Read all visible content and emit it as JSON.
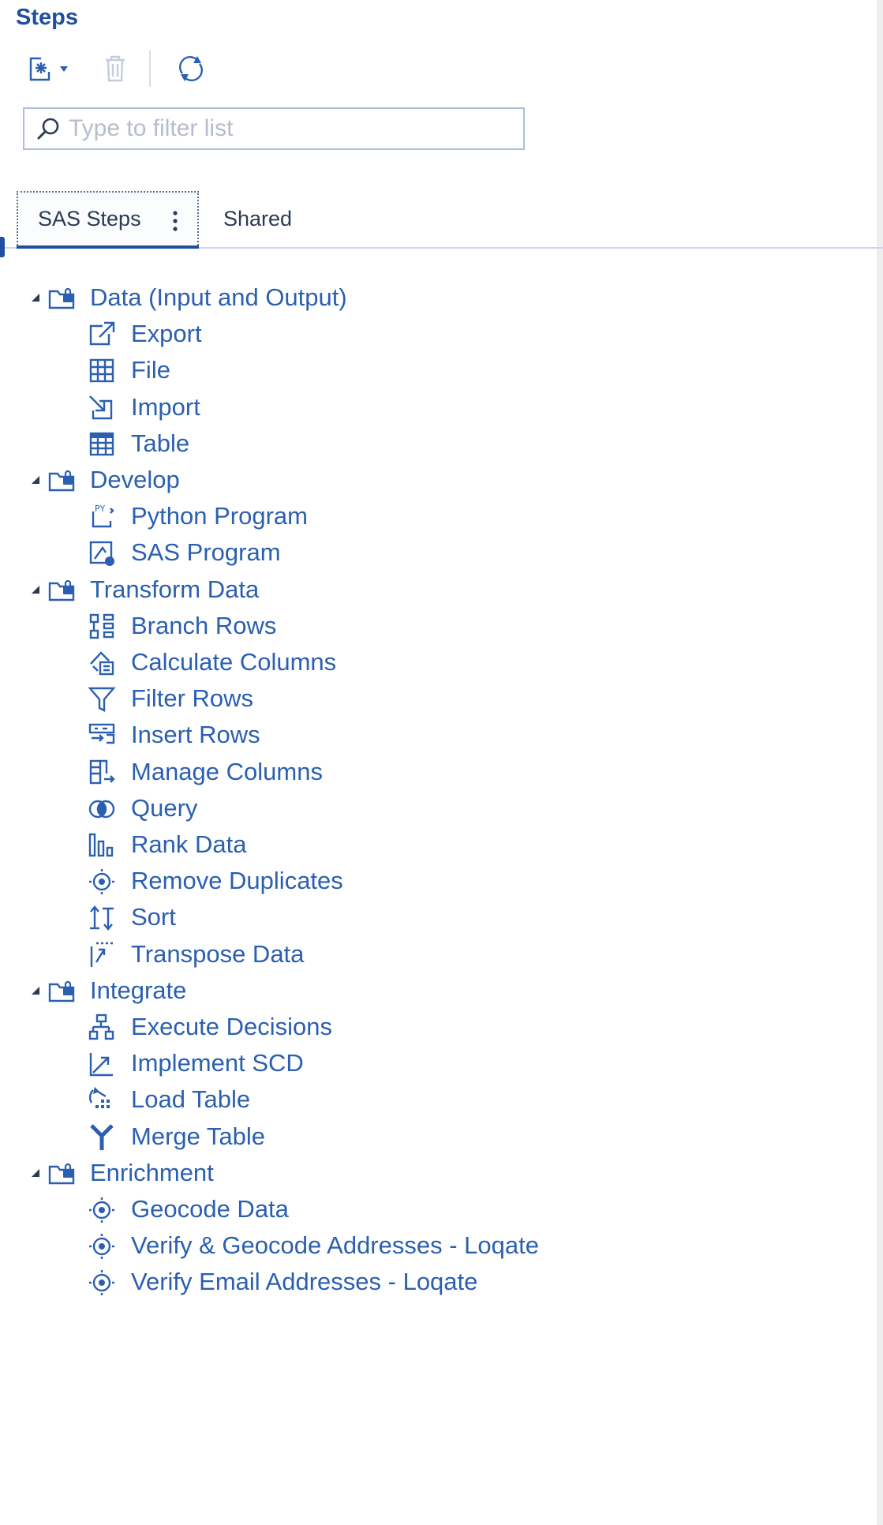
{
  "panel": {
    "title": "Steps"
  },
  "toolbar": {
    "new_icon": "new-step-icon",
    "delete_icon": "trash-icon",
    "refresh_icon": "refresh-icon"
  },
  "filter": {
    "placeholder": "Type to filter list",
    "value": ""
  },
  "tabs": [
    {
      "label": "SAS Steps",
      "active": true
    },
    {
      "label": "Shared",
      "active": false
    }
  ],
  "colors": {
    "accent": "#1f4f9e",
    "link": "#2b5fb0",
    "placeholder": "#b6bdca"
  },
  "tree": {
    "categories": [
      {
        "label": "Data (Input and Output)",
        "items": [
          {
            "label": "Export",
            "icon": "export-icon"
          },
          {
            "label": "File",
            "icon": "file-grid-icon"
          },
          {
            "label": "Import",
            "icon": "import-icon"
          },
          {
            "label": "Table",
            "icon": "table-icon"
          }
        ]
      },
      {
        "label": "Develop",
        "items": [
          {
            "label": "Python Program",
            "icon": "python-program-icon"
          },
          {
            "label": "SAS Program",
            "icon": "sas-program-icon"
          }
        ]
      },
      {
        "label": "Transform Data",
        "items": [
          {
            "label": "Branch Rows",
            "icon": "branch-rows-icon"
          },
          {
            "label": "Calculate Columns",
            "icon": "calculate-columns-icon"
          },
          {
            "label": "Filter Rows",
            "icon": "filter-icon"
          },
          {
            "label": "Insert Rows",
            "icon": "insert-rows-icon"
          },
          {
            "label": "Manage Columns",
            "icon": "manage-columns-icon"
          },
          {
            "label": "Query",
            "icon": "query-icon"
          },
          {
            "label": "Rank Data",
            "icon": "rank-data-icon"
          },
          {
            "label": "Remove Duplicates",
            "icon": "remove-duplicates-icon"
          },
          {
            "label": "Sort",
            "icon": "sort-icon"
          },
          {
            "label": "Transpose Data",
            "icon": "transpose-icon"
          }
        ]
      },
      {
        "label": "Integrate",
        "items": [
          {
            "label": "Execute Decisions",
            "icon": "execute-decisions-icon"
          },
          {
            "label": "Implement SCD",
            "icon": "implement-scd-icon"
          },
          {
            "label": "Load Table",
            "icon": "load-table-icon"
          },
          {
            "label": "Merge Table",
            "icon": "merge-table-icon"
          }
        ]
      },
      {
        "label": "Enrichment",
        "items": [
          {
            "label": "Geocode Data",
            "icon": "geocode-icon"
          },
          {
            "label": "Verify & Geocode Addresses - Loqate",
            "icon": "geocode-icon"
          },
          {
            "label": "Verify Email Addresses - Loqate",
            "icon": "geocode-icon"
          }
        ]
      }
    ]
  }
}
